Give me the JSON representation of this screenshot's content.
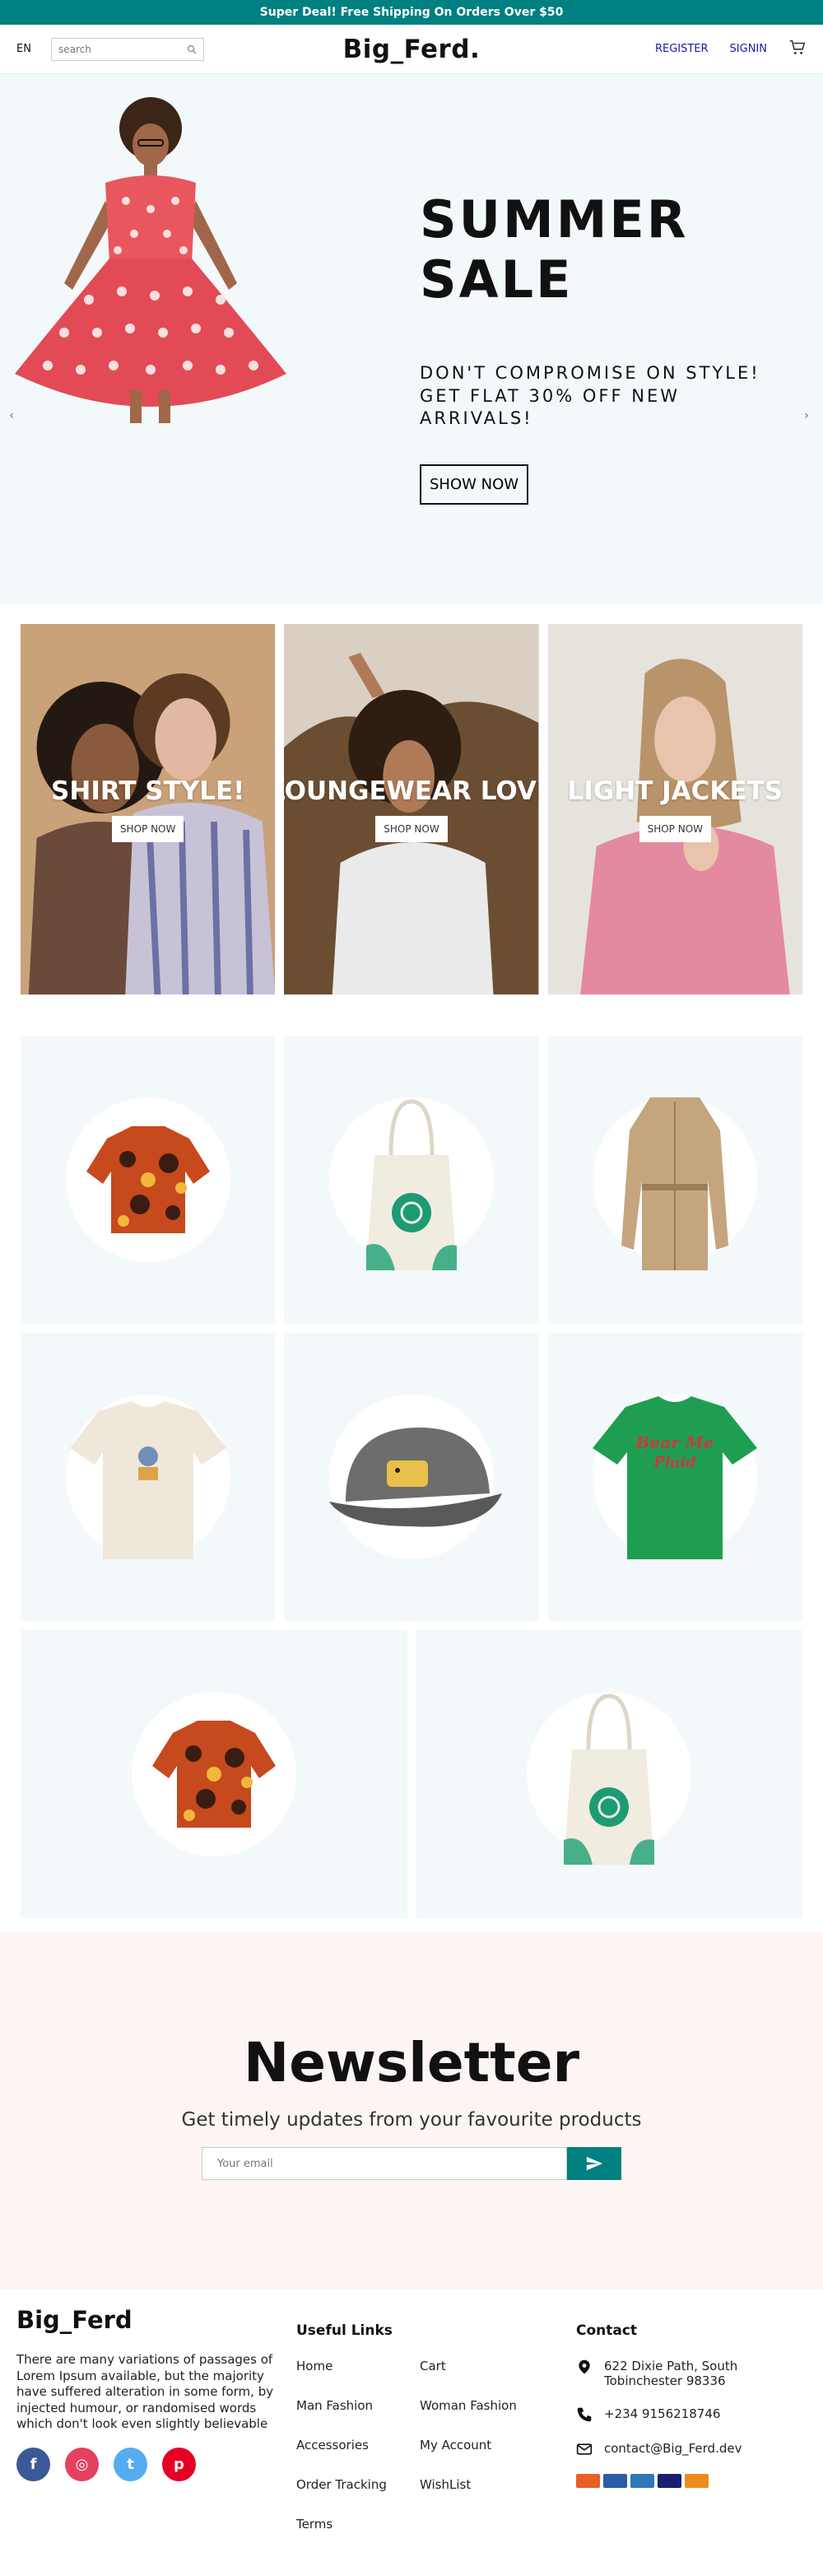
{
  "announcement": "Super Deal! Free Shipping On Orders Over $50",
  "nav": {
    "lang": "EN",
    "search_placeholder": "search",
    "logo": "Big_Ferd.",
    "register": "REGISTER",
    "signin": "SIGNIN",
    "cart_icon": "cart-icon"
  },
  "hero": {
    "title_line1": "SUMMER",
    "title_line2": "SALE",
    "description": "DON'T COMPROMISE ON STYLE! GET FLAT 30% OFF NEW ARRIVALS!",
    "button": "SHOW NOW",
    "bg_color": "#f3f8fb"
  },
  "categories": [
    {
      "title": "SHIRT STYLE!",
      "button": "SHOP NOW"
    },
    {
      "title": "LOUNGEWEAR LOVE",
      "button": "SHOP NOW"
    },
    {
      "title": "LIGHT JACKETS",
      "button": "SHOP NOW"
    }
  ],
  "newsletter": {
    "title": "Newsletter",
    "description": "Get timely updates from your favourite products",
    "placeholder": "Your email"
  },
  "footer": {
    "logo": "Big_Ferd",
    "description": "There are many variations of passages of Lorem Ipsum available, but the majority have suffered alteration in some form, by injected humour, or randomised words which don't look even slightly believable",
    "useful_links_title": "Useful Links",
    "links": [
      "Home",
      "Cart",
      "Man Fashion",
      "Woman Fashion",
      "Accessories",
      "My Account",
      "Order Tracking",
      "WishList",
      "Terms"
    ],
    "contact_title": "Contact",
    "address": "622 Dixie Path, South Tobinchester 98336",
    "phone": "+234 9156218746",
    "email": "contact@Big_Ferd.dev"
  },
  "colors": {
    "brand": "#008080",
    "link": "#1a1aa6",
    "newsletter_bg": "#fcf5f3"
  }
}
